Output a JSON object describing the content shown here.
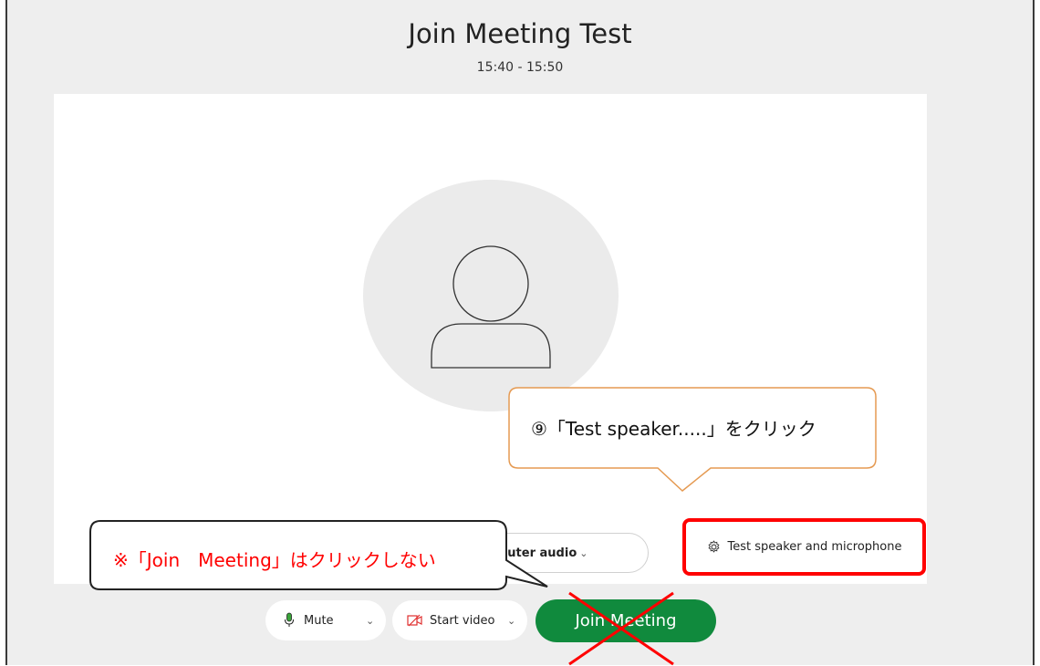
{
  "meeting": {
    "title": "Join Meeting Test",
    "time": "15:40 - 15:50"
  },
  "controls": {
    "audio_label": "puter audio",
    "mute_label": "Mute",
    "video_label": "Start video",
    "join_label": "Join Meeting",
    "test_label": "Test speaker and microphone"
  },
  "annotations": {
    "orange_callout": "⑨「Test speaker.....」をクリック",
    "red_callout": "※「Join　Meeting」はクリックしない"
  },
  "colors": {
    "join_green": "#108a3d",
    "highlight_red": "#ff0000",
    "callout_orange": "#e59a52"
  }
}
